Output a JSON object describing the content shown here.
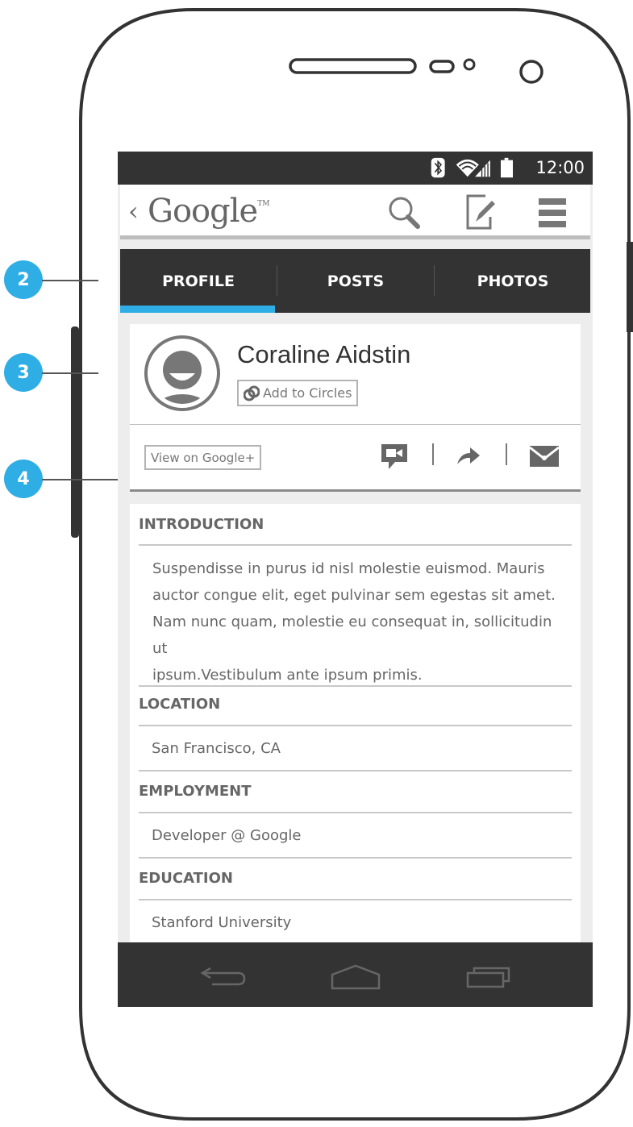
{
  "status_bar": {
    "time": "12:00",
    "icons": [
      "bluetooth-icon",
      "wifi-icon",
      "signal-icon",
      "battery-icon"
    ]
  },
  "action_bar": {
    "app_title": "Google",
    "trademark": "TM",
    "icons": [
      "search-icon",
      "compose-icon",
      "menu-icon"
    ]
  },
  "tabs": [
    {
      "label": "PROFILE",
      "selected": true
    },
    {
      "label": "POSTS",
      "selected": false
    },
    {
      "label": "PHOTOS",
      "selected": false
    }
  ],
  "profile": {
    "name": "Coraline Aidstin",
    "add_to_circles": "Add to Circles",
    "view_on_google_plus": "View on Google+",
    "action_icons": [
      "hangout-icon",
      "share-icon",
      "mail-icon"
    ]
  },
  "about": {
    "introduction": {
      "title": "INTRODUCTION",
      "text_lines": [
        "Suspendisse in purus id nisl molestie euismod. Mauris",
        "auctor congue elit, eget pulvinar sem egestas sit amet.",
        "Nam nunc quam, molestie eu consequat in, sollicitudin ut",
        "ipsum.Vestibulum ante ipsum primis."
      ]
    },
    "location": {
      "title": "LOCATION",
      "value": "San Francisco, CA"
    },
    "employment": {
      "title": "EMPLOYMENT",
      "value": "Developer @ Google"
    },
    "education": {
      "title": "EDUCATION",
      "value": "Stanford University"
    }
  },
  "callouts": [
    "2",
    "3",
    "4"
  ],
  "nav_bar": {
    "icons": [
      "back-icon",
      "home-icon",
      "recents-icon"
    ]
  },
  "colors": {
    "accent": "#2eaee5",
    "dark_bar": "#333333",
    "text": "#666666"
  }
}
